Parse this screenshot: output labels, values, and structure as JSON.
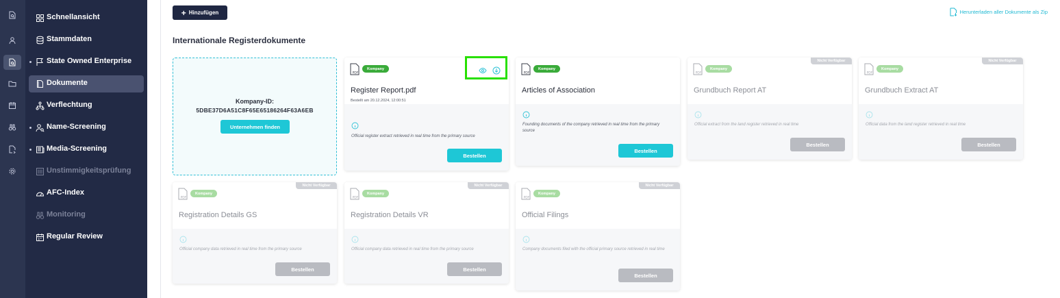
{
  "colors": {
    "accent": "#1ec7d6",
    "sidebar_bg": "#222a45",
    "rail_bg": "#2c3550",
    "badge_green": "#3aab3a",
    "highlight": "#27e000"
  },
  "rail": {
    "icons": [
      "document-search-icon",
      "person-icon",
      "document-search-icon",
      "folder-icon",
      "calendar-icon",
      "binoculars-icon",
      "document-share-icon",
      "gear-icon"
    ],
    "active_index": 2
  },
  "sidebar": {
    "items": [
      {
        "label": "Schnellansicht",
        "icon": "grid-icon",
        "disabled": false,
        "active": false,
        "bullet": false
      },
      {
        "label": "Stammdaten",
        "icon": "database-icon",
        "disabled": false,
        "active": false,
        "bullet": false
      },
      {
        "label": "State Owned Enterprise",
        "icon": "flag-icon",
        "disabled": false,
        "active": false,
        "bullet": true
      },
      {
        "label": "Dokumente",
        "icon": "document-icon",
        "disabled": false,
        "active": true,
        "bullet": false
      },
      {
        "label": "Verflechtung",
        "icon": "network-icon",
        "disabled": false,
        "active": false,
        "bullet": false
      },
      {
        "label": "Name-Screening",
        "icon": "person-search-icon",
        "disabled": false,
        "active": false,
        "bullet": true
      },
      {
        "label": "Media-Screening",
        "icon": "newspaper-icon",
        "disabled": false,
        "active": false,
        "bullet": true
      },
      {
        "label": "Unstimmigkeitsprüfung",
        "icon": "sliders-icon",
        "disabled": true,
        "active": false,
        "bullet": false
      },
      {
        "label": "AFC-Index",
        "icon": "gauge-icon",
        "disabled": false,
        "active": false,
        "bullet": false
      },
      {
        "label": "Monitoring",
        "icon": "binoculars-icon",
        "disabled": true,
        "active": false,
        "bullet": false
      },
      {
        "label": "Regular Review",
        "icon": "calendar-icon",
        "disabled": false,
        "active": false,
        "bullet": false
      }
    ]
  },
  "toolbar": {
    "add_plus": "+",
    "add_label": "Hinzufügen",
    "download_all_label": "Herunterladen aller Dokumente als Zip"
  },
  "section": {
    "title": "Internationale Registerdokumente"
  },
  "search_card": {
    "id_label": "Kompany-ID:",
    "id_value": "5DBE37D6A51C8F65E65186264F63A6EB",
    "find_button": "Unternehmen finden"
  },
  "cards": [
    {
      "badge": "Kompany",
      "title": "Register Report.pdf",
      "date": "Bestellt am 20.12.2024, 12:00:51",
      "description": "Official register extract retrieved in real time from the primary source",
      "button": "Bestellen",
      "available": true,
      "has_actions": true,
      "unavailable_label": ""
    },
    {
      "badge": "Kompany",
      "title": "Articles of Association",
      "date": "",
      "description": "Founding documents of the company retrieved in real time from the primary source",
      "button": "Bestellen",
      "available": true,
      "has_actions": false,
      "unavailable_label": ""
    },
    {
      "badge": "Kompany",
      "title": "Grundbuch Report AT",
      "date": "",
      "description": "Official extract from the land register retrieved in real time",
      "button": "Bestellen",
      "available": false,
      "has_actions": false,
      "unavailable_label": "Nicht Verfügbar"
    },
    {
      "badge": "Kompany",
      "title": "Grundbuch Extract AT",
      "date": "",
      "description": "Official data from the land register retrieved in real time",
      "button": "Bestellen",
      "available": false,
      "has_actions": false,
      "unavailable_label": "Nicht Verfügbar"
    },
    {
      "badge": "Kompany",
      "title": "Registration Details GS",
      "date": "",
      "description": "Official company data retrieved in real time from the primary source",
      "button": "Bestellen",
      "available": false,
      "has_actions": false,
      "unavailable_label": "Nicht Verfügbar"
    },
    {
      "badge": "Kompany",
      "title": "Registration Details VR",
      "date": "",
      "description": "Official company data retrieved in real time from the primary source",
      "button": "Bestellen",
      "available": false,
      "has_actions": false,
      "unavailable_label": "Nicht Verfügbar"
    },
    {
      "badge": "Kompany",
      "title": "Official Filings",
      "date": "",
      "description": "Company documents filed with the official primary source retrieved in real time",
      "button": "Bestellen",
      "available": false,
      "has_actions": false,
      "unavailable_label": "Nicht Verfügbar"
    }
  ]
}
